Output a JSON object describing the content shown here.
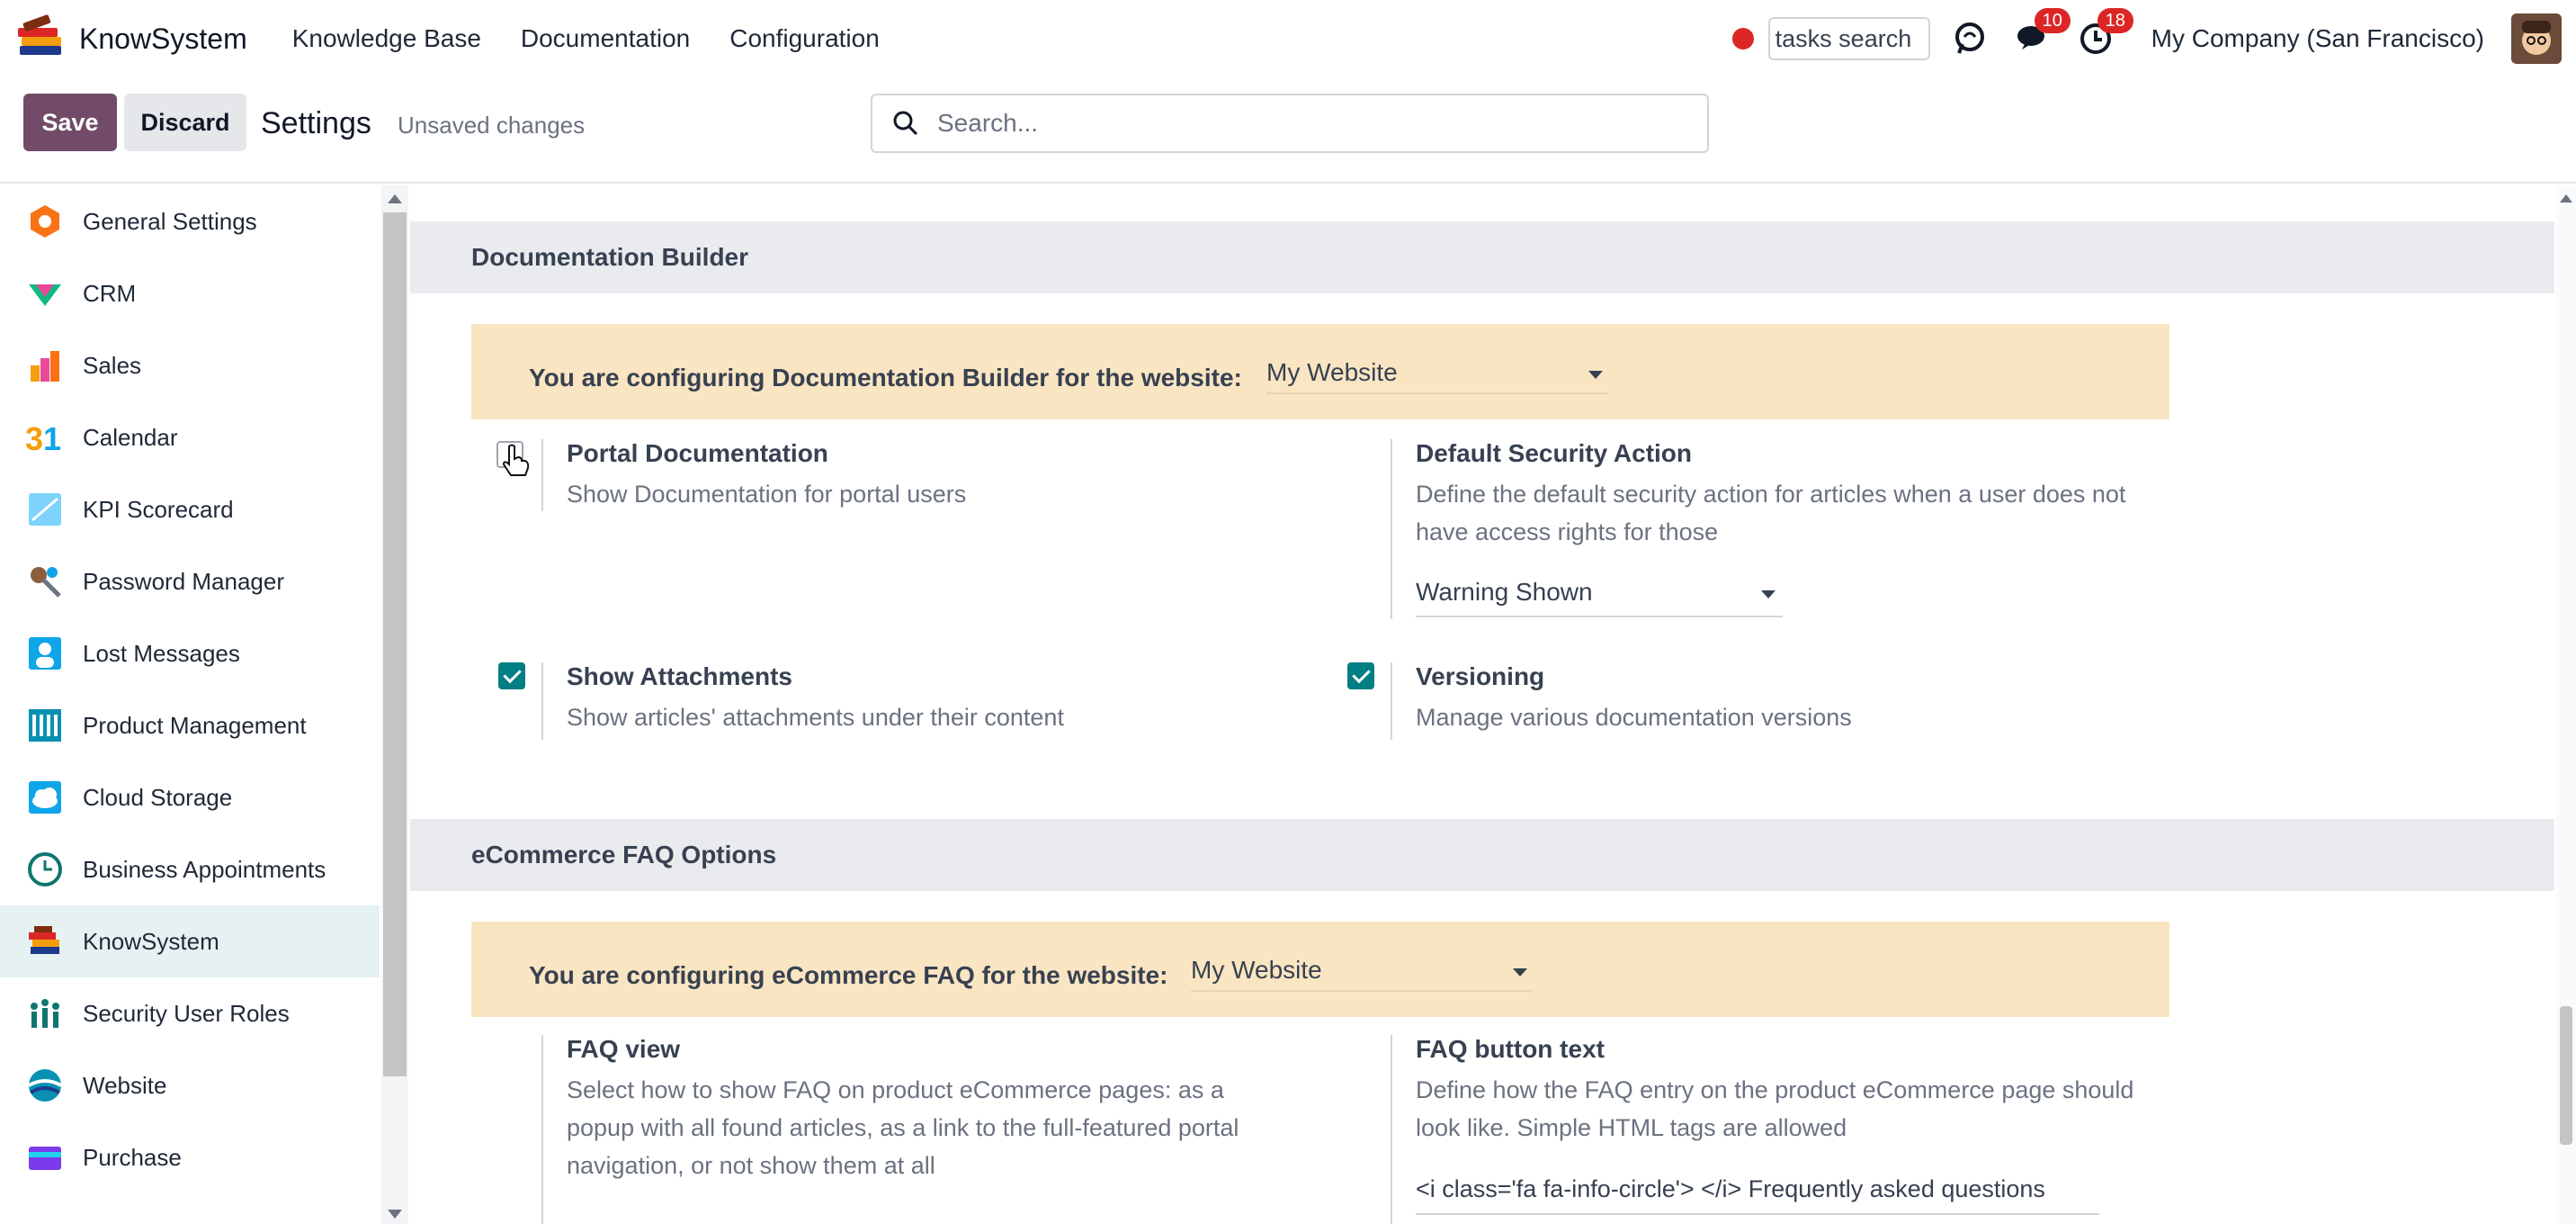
{
  "navbar": {
    "brand": "KnowSystem",
    "menus": [
      "Knowledge Base",
      "Documentation",
      "Configuration"
    ],
    "task_search_value": "tasks search",
    "messages_count": "10",
    "activities_count": "18",
    "company": "My Company (San Francisco)"
  },
  "control_panel": {
    "save_label": "Save",
    "discard_label": "Discard",
    "title": "Settings",
    "status": "Unsaved changes",
    "search_placeholder": "Search..."
  },
  "sidebar": {
    "items": [
      {
        "label": "General Settings",
        "icon": "general-settings-icon",
        "color": "#f97316"
      },
      {
        "label": "CRM",
        "icon": "crm-icon",
        "color": "#10b981"
      },
      {
        "label": "Sales",
        "icon": "sales-icon",
        "color": "#f59e0b"
      },
      {
        "label": "Calendar",
        "icon": "calendar-icon",
        "color": "#f59e0b"
      },
      {
        "label": "KPI Scorecard",
        "icon": "kpi-scorecard-icon",
        "color": "#38bdf8"
      },
      {
        "label": "Password Manager",
        "icon": "password-manager-icon",
        "color": "#8b5e3c"
      },
      {
        "label": "Lost Messages",
        "icon": "lost-messages-icon",
        "color": "#0ea5e9"
      },
      {
        "label": "Product Management",
        "icon": "product-management-icon",
        "color": "#0891b2"
      },
      {
        "label": "Cloud Storage",
        "icon": "cloud-storage-icon",
        "color": "#0ea5e9"
      },
      {
        "label": "Business Appointments",
        "icon": "business-appointments-icon",
        "color": "#0f766e"
      },
      {
        "label": "KnowSystem",
        "icon": "knowsystem-icon",
        "color": "#dc2626",
        "active": true
      },
      {
        "label": "Security User Roles",
        "icon": "security-user-roles-icon",
        "color": "#0f766e"
      },
      {
        "label": "Website",
        "icon": "website-icon",
        "color": "#0891b2"
      },
      {
        "label": "Purchase",
        "icon": "purchase-icon",
        "color": "#7c3aed"
      }
    ]
  },
  "documentation_builder": {
    "heading": "Documentation Builder",
    "website_label": "You are configuring Documentation Builder for the website:",
    "website_value": "My Website",
    "portal_documentation": {
      "title": "Portal Documentation",
      "desc": "Show Documentation for portal users",
      "checked": false
    },
    "default_security_action": {
      "title": "Default Security Action",
      "desc": "Define the default security action for articles when a user does not have access rights for those",
      "value": "Warning Shown"
    },
    "show_attachments": {
      "title": "Show Attachments",
      "desc": "Show articles' attachments under their content",
      "checked": true
    },
    "versioning": {
      "title": "Versioning",
      "desc": "Manage various documentation versions",
      "checked": true
    }
  },
  "ecommerce_faq": {
    "heading": "eCommerce FAQ Options",
    "website_label": "You are configuring eCommerce FAQ for the website:",
    "website_value": "My Website",
    "faq_view": {
      "title": "FAQ view",
      "desc": "Select how to show FAQ on product eCommerce pages: as a popup with all found articles, as a link to the full-featured portal navigation, or not show them at all"
    },
    "faq_button_text": {
      "title": "FAQ button text",
      "desc": "Define how the FAQ entry on the product eCommerce page should look like. Simple HTML tags are allowed",
      "value": "<i class='fa fa-info-circle'> </i> Frequently asked questions"
    }
  },
  "colors": {
    "brand": "#714b67",
    "accent": "#017e84",
    "warning_bg": "#fae5c2",
    "badge": "#dc2626"
  }
}
